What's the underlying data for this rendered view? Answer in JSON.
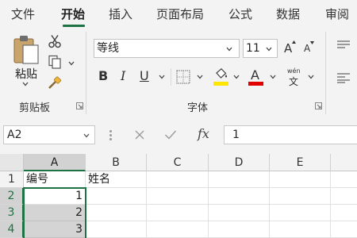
{
  "ribbon_tabs": [
    {
      "label": "文件"
    },
    {
      "label": "开始"
    },
    {
      "label": "插入"
    },
    {
      "label": "页面布局"
    },
    {
      "label": "公式"
    },
    {
      "label": "数据"
    },
    {
      "label": "审阅"
    }
  ],
  "active_tab": "开始",
  "clipboard": {
    "paste_label": "粘贴",
    "group_label": "剪贴板",
    "icons": [
      "paste-icon",
      "cut-icon",
      "copy-icon",
      "format-painter-icon"
    ]
  },
  "font": {
    "font_name": "等线",
    "font_size": "11",
    "group_label": "字体",
    "bold_label": "B",
    "italic_label": "I",
    "underline_label": "U",
    "grow_label": "A",
    "shrink_label": "A",
    "phonetic_label": "wén",
    "phonetic_char": "文",
    "fill_color": "#ffe600",
    "font_color": "#e00000"
  },
  "formula_bar": {
    "name_box": "A2",
    "formula": "1",
    "fx_label": "fx"
  },
  "grid": {
    "columns": [
      "A",
      "B",
      "C",
      "D",
      "E"
    ],
    "rows": [
      "1",
      "2",
      "3",
      "4"
    ],
    "cells": {
      "A1": "编号",
      "B1": "姓名",
      "A2": "1",
      "A3": "2",
      "A4": "3"
    }
  },
  "colors": {
    "accent": "#1f7244",
    "ribbon_bg": "#f3f3f3",
    "selection": "#d4d4d4"
  }
}
